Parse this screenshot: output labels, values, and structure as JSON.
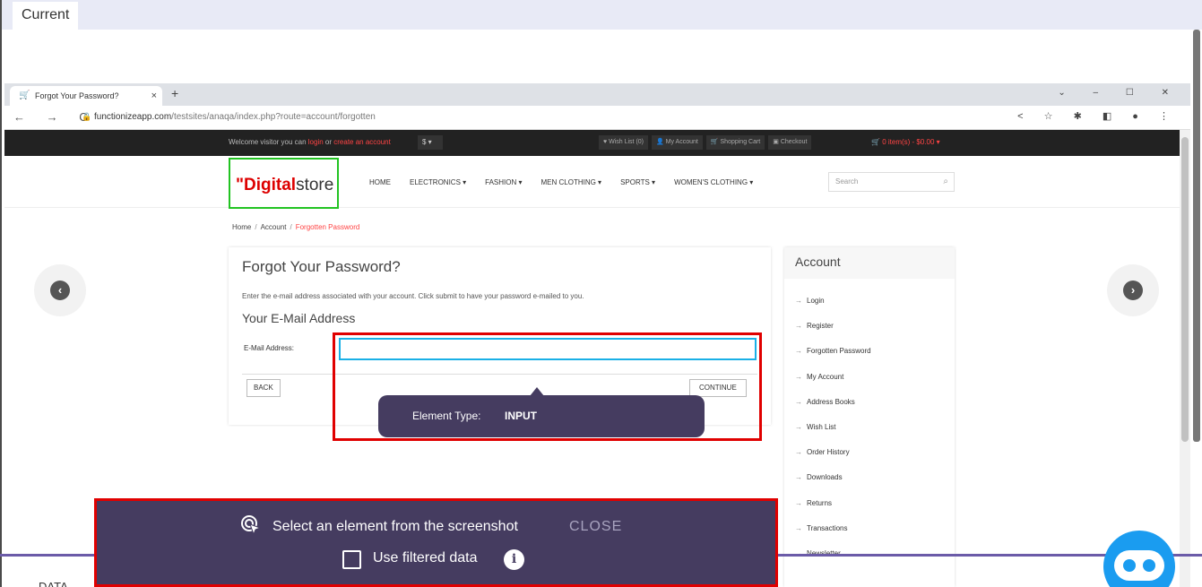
{
  "app": {
    "current_tab": "Current"
  },
  "browser": {
    "tab_title": "Forgot Your Password?",
    "tab_close": "×",
    "new_tab": "+",
    "window_controls": "⌄ – ☐ ✕",
    "nav_buttons": "← → C",
    "lock_icon": "🔒",
    "url_host": "functionizeapp.com",
    "url_path": "/testsites/anaqa/index.php?route=account/forgotten",
    "toolbar_icons": "< ☆ ✱ ◧ ● ⋮"
  },
  "site_topbar": {
    "welcome_prefix": "Welcome visitor you can ",
    "login_link": "login",
    "or_text": " or ",
    "create_link": "create an account",
    "currency": "$ ▾",
    "links": [
      "♥ Wish List (0)",
      "👤 My Account",
      "🛒 Shopping Cart",
      "▣ Checkout"
    ],
    "cart_icon": "🛒",
    "cart_text": " 0 item(s) - $0.00 ▾"
  },
  "site_header": {
    "logo_mark": "\"",
    "logo_bold": "Digital",
    "logo_light": "store",
    "menu": [
      "HOME",
      "ELECTRONICS ▾",
      "FASHION ▾",
      "MEN CLOTHING ▾",
      "SPORTS ▾",
      "WOMEN'S CLOTHING ▾"
    ],
    "search_placeholder": "Search",
    "search_icon": "⌕"
  },
  "breadcrumb": {
    "home": "Home",
    "sep": "/",
    "account": "Account",
    "current": "Forgotten Password"
  },
  "main": {
    "title": "Forgot Your Password?",
    "intro": "Enter the e-mail address associated with your account. Click submit to have your password e-mailed to you.",
    "section_title": "Your E-Mail Address",
    "email_label": "E-Mail Address:",
    "email_value": "",
    "back_label": "BACK",
    "continue_label": "CONTINUE"
  },
  "account": {
    "title": "Account",
    "items": [
      "Login",
      "Register",
      "Forgotten Password",
      "My Account",
      "Address Books",
      "Wish List",
      "Order History",
      "Downloads",
      "Returns",
      "Transactions",
      "Newsletter"
    ]
  },
  "carousel": {
    "prev": "‹",
    "next": "›"
  },
  "tooltip": {
    "key": "Element Type:",
    "value": "INPUT"
  },
  "selector": {
    "prompt": "Select an element from the screenshot",
    "close": "CLOSE",
    "filter_label": "Use filtered data",
    "info_glyph": "i"
  },
  "bottom": {
    "data_label": "DATA"
  }
}
